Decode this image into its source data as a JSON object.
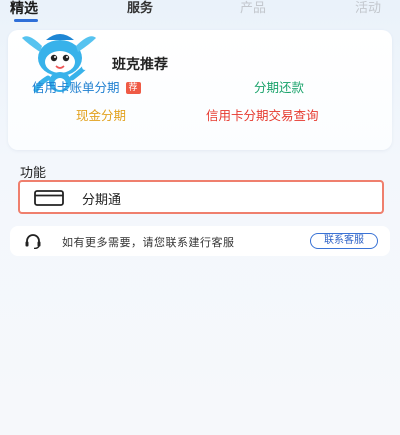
{
  "tabs": [
    {
      "label": "精选"
    },
    {
      "label": "服务"
    },
    {
      "label": "产品"
    },
    {
      "label": "活动"
    }
  ],
  "recommend": {
    "title": "班克推荐",
    "links": [
      {
        "label": "信用卡账单分期",
        "badge": "荐",
        "color": "#1e7fd0"
      },
      {
        "label": "分期还款",
        "color": "#1aa36b"
      },
      {
        "label": "现金分期",
        "color": "#e2a21f"
      },
      {
        "label": "信用卡分期交易查询",
        "color": "#e6392e"
      }
    ]
  },
  "functions": {
    "title": "功能",
    "items": [
      {
        "label": "分期通",
        "icon": "card-icon"
      }
    ]
  },
  "contact": {
    "text": "如有更多需要，请您联系建行客服",
    "button": "联系客服",
    "icon": "headset-icon"
  },
  "colors": {
    "accent": "#2f6fd8",
    "highlight_border": "#ef7f6d",
    "badge": "#ef5a45"
  }
}
